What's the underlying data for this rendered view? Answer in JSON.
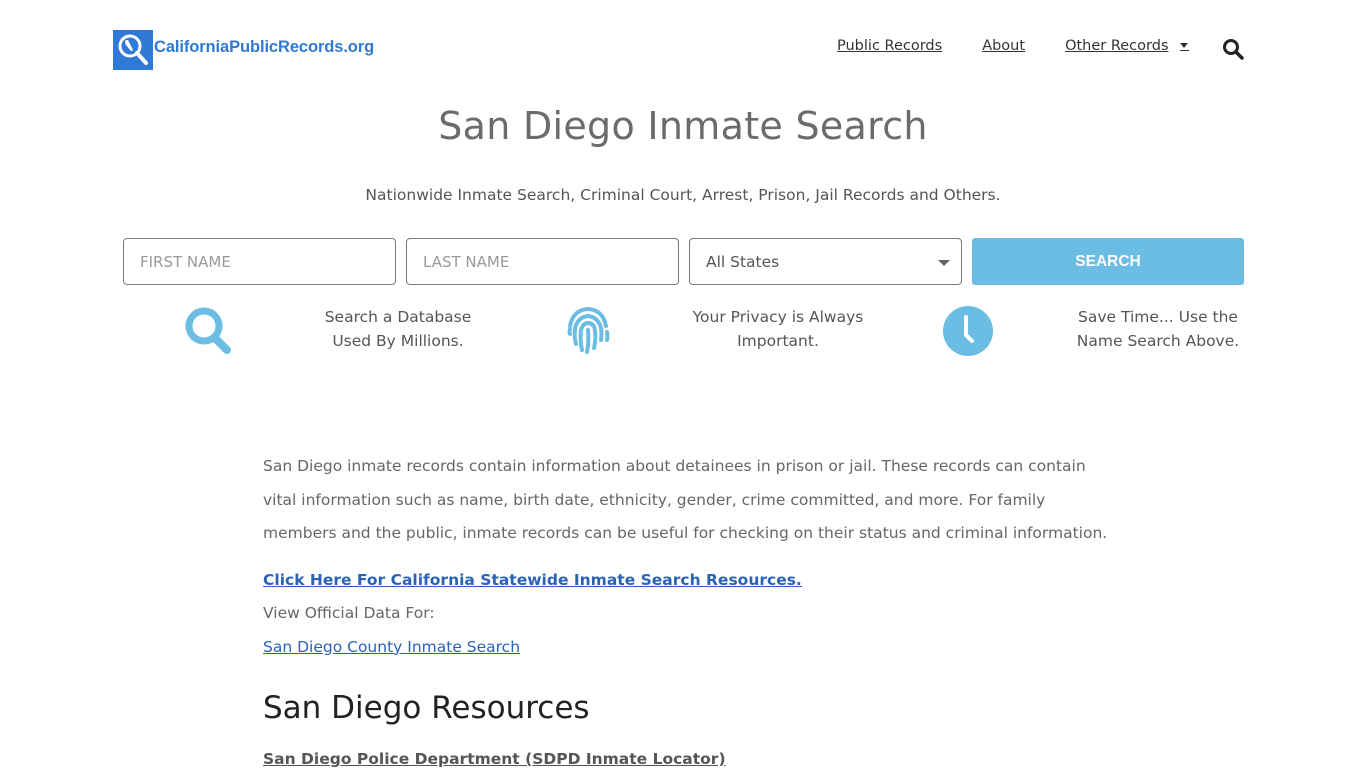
{
  "header": {
    "logo_text": "CaliforniaPublicRecords.org",
    "nav": [
      {
        "label": "Public Records"
      },
      {
        "label": "About"
      },
      {
        "label": "Other Records",
        "has_dropdown": true
      }
    ],
    "search_icon": "search-icon"
  },
  "hero": {
    "title": "San Diego Inmate Search",
    "subtitle": "Nationwide Inmate Search, Criminal Court, Arrest, Prison, Jail Records and Others."
  },
  "search_form": {
    "first_name": {
      "value": "",
      "placeholder": "FIRST NAME"
    },
    "last_name": {
      "value": "",
      "placeholder": "LAST NAME"
    },
    "state_select": {
      "selected": "All States"
    },
    "submit_label": "SEARCH"
  },
  "features": [
    {
      "icon": "search-icon",
      "line1": "Search a Database",
      "line2": "Used By Millions."
    },
    {
      "icon": "fingerprint-icon",
      "line1": "Your Privacy is Always",
      "line2": "Important."
    },
    {
      "icon": "clock-icon",
      "line1": "Save Time... Use the",
      "line2": "Name Search Above."
    }
  ],
  "content": {
    "intro": "San Diego inmate records contain information about detainees in prison or jail. These records can contain vital information such as name, birth date, ethnicity, gender, crime committed, and more. For family members and the public, inmate records can be useful for checking on their status and criminal information.",
    "statewide_link": "Click Here For California Statewide Inmate Search Resources.",
    "official_label": "View Official Data For:",
    "county_link": "San Diego County Inmate Search",
    "resources_title": "San Diego Resources",
    "resources": [
      {
        "label": "San Diego Police Department (SDPD Inmate Locator)"
      }
    ]
  },
  "colors": {
    "brand_blue": "#2f7ad6",
    "accent_light_blue": "#6bbde3",
    "link_blue": "#2a63b5"
  }
}
